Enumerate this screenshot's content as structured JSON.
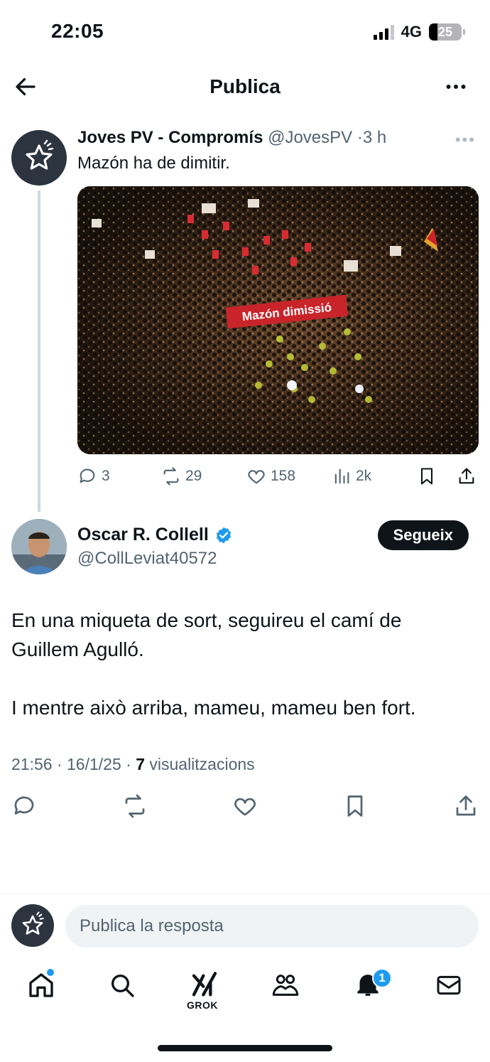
{
  "status_bar": {
    "time": "22:05",
    "network": "4G",
    "battery": "25"
  },
  "header": {
    "title": "Publica"
  },
  "parent_tweet": {
    "name": "Joves PV - Compromís",
    "handle": "@JovesPV",
    "separator": "·",
    "time": "3 h",
    "text": "Mazón ha de dimitir.",
    "image_banner": "Mazón dimissió",
    "stats": {
      "replies": "3",
      "reposts": "29",
      "likes": "158",
      "views": "2k"
    }
  },
  "main_tweet": {
    "name": "Oscar R. Collell",
    "handle": "@CollLeviat40572",
    "follow_label": "Segueix",
    "text_lines": [
      "En una miqueta de sort, seguireu el camí de",
      "Guillem Agulló.",
      "I mentre això arriba, mameu, mameu ben fort."
    ],
    "timestamp": "21:56 · 16/1/25 · ",
    "views_count": "7",
    "views_label": " visualitzacions"
  },
  "reply": {
    "placeholder": "Publica la resposta"
  },
  "bottom_nav": {
    "grok_label": "GROK",
    "notifications_count": "1"
  },
  "colors": {
    "accent": "#1d9bf0",
    "text": "#0f1419",
    "muted": "#536471",
    "banner_red": "#c8242a"
  }
}
